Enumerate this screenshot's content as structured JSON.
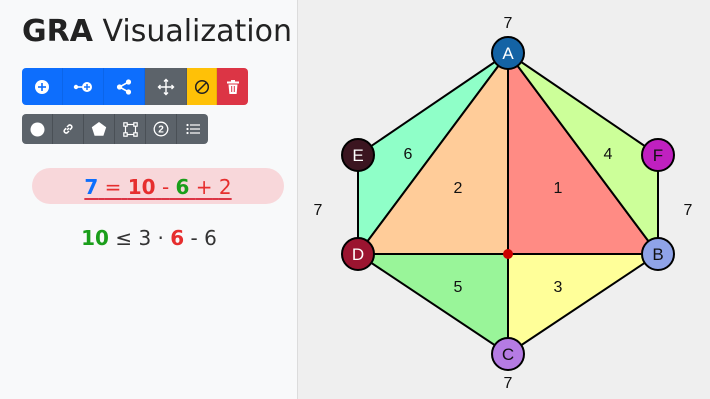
{
  "sidebar": {
    "title_bold": "GRA",
    "title_rest": "Visualization",
    "toolbar_main": [
      {
        "name": "add-node-button",
        "icon": "plus-circle-icon",
        "color": "#0d6efd"
      },
      {
        "name": "add-edge-button",
        "icon": "edge-plus-icon",
        "color": "#0d6efd"
      },
      {
        "name": "share-button",
        "icon": "share-icon",
        "color": "#0d6efd"
      },
      {
        "name": "move-button",
        "icon": "move-arrows-icon",
        "color": "#5c636a"
      },
      {
        "name": "disable-button",
        "icon": "slash-circle-icon",
        "color": "#ffc107"
      },
      {
        "name": "delete-button",
        "icon": "trash-icon",
        "color": "#dc3545"
      }
    ],
    "toolbar_secondary": [
      {
        "name": "circle-tool-button",
        "icon": "circle-icon"
      },
      {
        "name": "link-tool-button",
        "icon": "link-icon"
      },
      {
        "name": "polygon-tool-button",
        "icon": "pentagon-icon"
      },
      {
        "name": "bounding-box-button",
        "icon": "bounding-box-icon"
      },
      {
        "name": "number-tool-button",
        "icon": "circled-2-icon"
      },
      {
        "name": "list-tool-button",
        "icon": "list-icon"
      }
    ],
    "equation": {
      "lhs": "7",
      "eq": "=",
      "t1": "10",
      "op1": "-",
      "t2": "6",
      "op2": "+",
      "t3": "2"
    },
    "inequality": {
      "lhs": "10",
      "rel": "≤ 3 ·",
      "mid": "6",
      "rest": "- 6"
    }
  },
  "graph": {
    "nodes": [
      {
        "id": "A",
        "label": "A",
        "color": "#1463a5"
      },
      {
        "id": "B",
        "label": "B",
        "color": "#8fa3e8"
      },
      {
        "id": "C",
        "label": "C",
        "color": "#b57be3"
      },
      {
        "id": "D",
        "label": "D",
        "color": "#9b1430"
      },
      {
        "id": "E",
        "label": "E",
        "color": "#3b1520"
      },
      {
        "id": "F",
        "label": "F",
        "color": "#c020c0"
      }
    ],
    "faces": [
      {
        "label": "1",
        "color": "#ff8b84"
      },
      {
        "label": "2",
        "color": "#ffcc99"
      },
      {
        "label": "3",
        "color": "#ffff99"
      },
      {
        "label": "4",
        "color": "#ccff99"
      },
      {
        "label": "5",
        "color": "#99f599"
      },
      {
        "label": "6",
        "color": "#8fffc8"
      }
    ],
    "outer_labels": [
      "7",
      "7",
      "7",
      "7"
    ],
    "center_color": "#cc0000"
  }
}
